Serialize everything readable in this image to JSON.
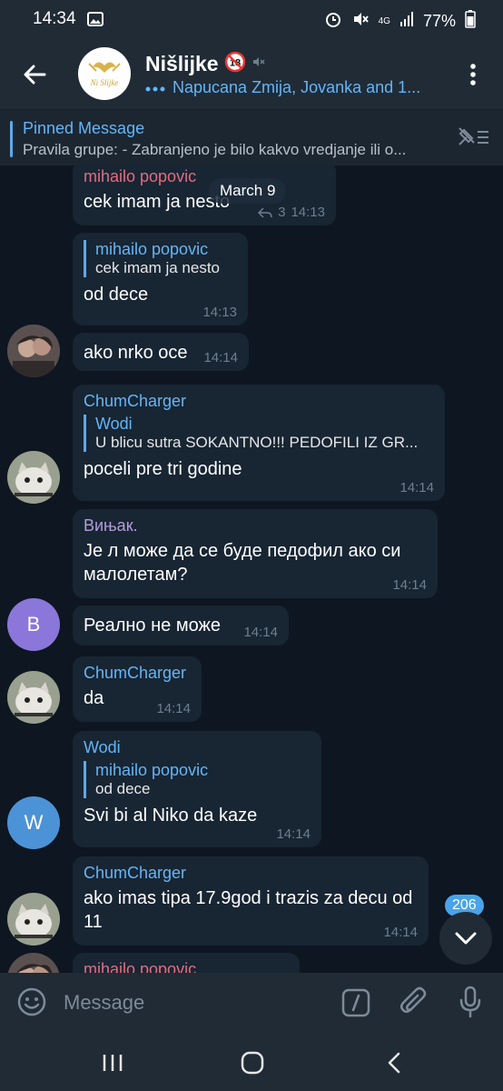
{
  "status_bar": {
    "time": "14:34",
    "network": "4G",
    "battery": "77%"
  },
  "header": {
    "title": "Nišlijke",
    "title_badge": "18",
    "subtitle": "Napucana Zmija, Jovanka and 1...",
    "avatar_text": "Ni Slijke"
  },
  "pinned": {
    "label": "Pinned Message",
    "text": "Pravila grupe:  - Zabranjeno je bilo kakvo vredjanje ili o..."
  },
  "chat": {
    "date": "March 9",
    "messages": [
      {
        "sender": "mihailo popovic",
        "text": "cek imam ja nesto",
        "replies": "3",
        "time": "14:13"
      },
      {
        "quote_name": "mihailo popovic",
        "quote_text": "cek imam ja nesto",
        "text": "od dece",
        "time": "14:13"
      },
      {
        "text": "ako nrko oce",
        "time": "14:14"
      },
      {
        "sender": "ChumCharger",
        "quote_name": "Wodi",
        "quote_text": "U blicu sutra SOKANTNO!!! PEDOFILI IZ GR...",
        "text": "poceli pre tri godine",
        "time": "14:14"
      },
      {
        "sender": "Вињак.",
        "text": "Је л може да се буде педофил ако си малолетам?",
        "time": "14:14"
      },
      {
        "avatar_letter": "B",
        "text": "Реално не може",
        "time": "14:14"
      },
      {
        "sender": "ChumCharger",
        "text": "da",
        "time": "14:14"
      },
      {
        "sender": "Wodi",
        "avatar_letter": "W",
        "quote_name": "mihailo popovic",
        "quote_text": "od dece",
        "text": "Svi bi al Niko da kaze",
        "time": "14:14"
      },
      {
        "sender": "ChumCharger",
        "text": "ako imas tipa 17.9god i trazis za decu od 11",
        "time": "14:14"
      },
      {
        "sender": "mihailo popovic"
      }
    ]
  },
  "unread_count": "206",
  "input": {
    "placeholder": "Message"
  },
  "colors": {
    "background": "#0e1621",
    "bubble": "#182533",
    "bar": "#202b36",
    "accent": "#64b5f6",
    "name_pink": "#e56b7f",
    "name_purple": "#b39ddb",
    "avatar_b": "#8a77d9",
    "avatar_w": "#4b93d6"
  },
  "icons": [
    "image-icon",
    "alarm-icon",
    "mute-icon",
    "signal-icon",
    "battery-icon",
    "back-arrow-icon",
    "muted-speaker-icon",
    "more-vert-icon",
    "unpin-icon",
    "reply-icon",
    "chevron-down-icon",
    "emoji-icon",
    "slash-command-icon",
    "paperclip-icon",
    "microphone-icon",
    "recents-icon",
    "home-icon",
    "back-nav-icon"
  ]
}
